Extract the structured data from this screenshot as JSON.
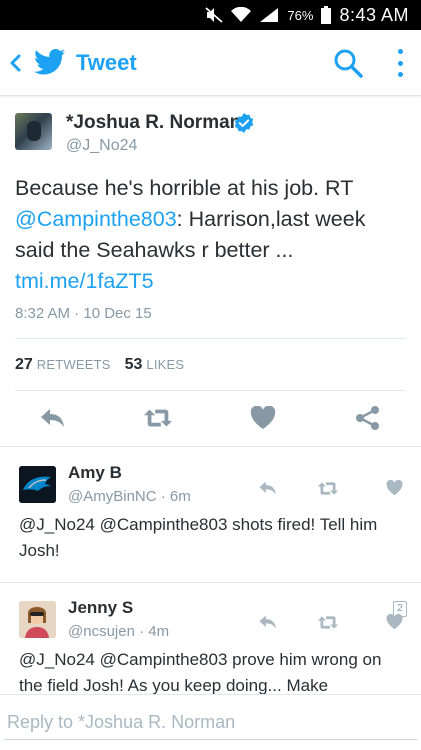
{
  "status_bar": {
    "battery": "76%",
    "time": "8:43 AM"
  },
  "app_bar": {
    "title": "Tweet"
  },
  "tweet": {
    "author_name": "*Joshua R. Norman",
    "handle": "@J_No24",
    "text_1": "Because he's horrible at his job. RT ",
    "mention": "@Campinthe803",
    "text_2": ": Harrison,last week said the Seahawks r better ... ",
    "link": "tmi.me/1faZT5",
    "timestamp": "8:32 AM · 10 Dec 15",
    "retweets_count": "27",
    "retweets_label": "RETWEETS",
    "likes_count": "53",
    "likes_label": "LIKES"
  },
  "replies": [
    {
      "name": "Amy B",
      "handle": "@AmyBinNC · 6m",
      "text": "@J_No24 @Campinthe803 shots fired!  Tell him Josh!"
    },
    {
      "name": "Jenny S",
      "handle": "@ncsujen · 4m",
      "text": "@J_No24 @Campinthe803 prove him wrong on the field Josh! As you keep doing... Make",
      "like_badge": "2"
    }
  ],
  "reply_bar": {
    "placeholder": "Reply to *Joshua R. Norman"
  },
  "colors": {
    "accent": "#1da1f2",
    "muted": "#8899a6",
    "text": "#292f33",
    "icon": "#8899a6"
  }
}
